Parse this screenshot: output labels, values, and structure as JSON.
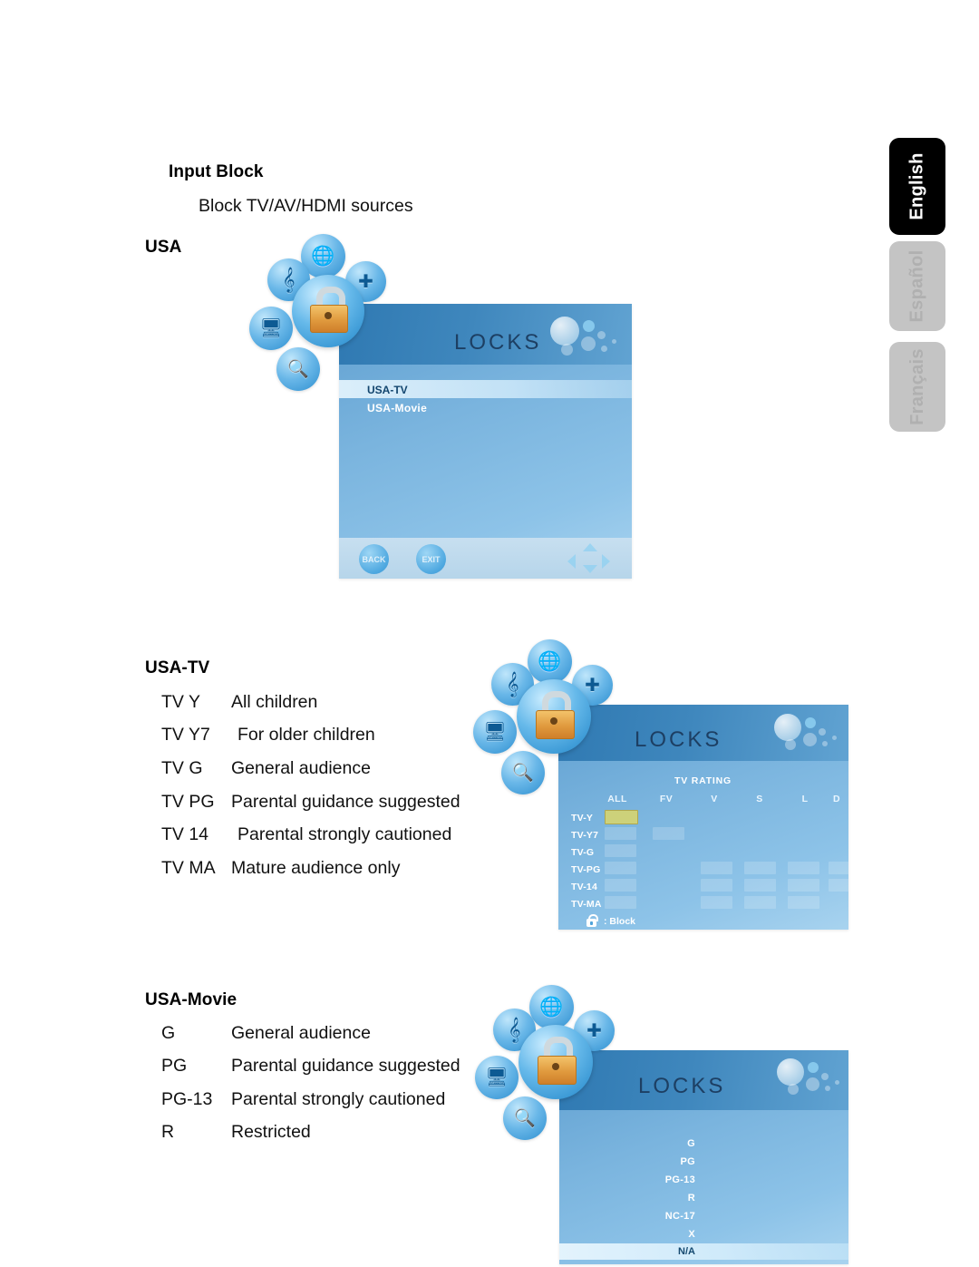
{
  "page": {
    "heading": "Input Block",
    "subheading": "Block TV/AV/HDMI sources",
    "usa_label": "USA"
  },
  "language_tabs": [
    {
      "label": "English",
      "active": true
    },
    {
      "label": "Español",
      "active": false
    },
    {
      "label": "Français",
      "active": false
    }
  ],
  "usa_tv": {
    "heading": "USA-TV",
    "rows": [
      {
        "code": "TV Y",
        "desc": "All children"
      },
      {
        "code": "TV Y7",
        "desc": "For older children"
      },
      {
        "code": "TV G",
        "desc": "General audience"
      },
      {
        "code": "TV PG",
        "desc": "Parental guidance suggested"
      },
      {
        "code": "TV 14",
        "desc": "Parental strongly cautioned"
      },
      {
        "code": "TV MA",
        "desc": "Mature audience only"
      }
    ]
  },
  "usa_movie": {
    "heading": "USA-Movie",
    "rows": [
      {
        "code": "G",
        "desc": "General audience"
      },
      {
        "code": "PG",
        "desc": "Parental guidance suggested"
      },
      {
        "code": "PG-13",
        "desc": "Parental strongly cautioned"
      },
      {
        "code": "R",
        "desc": "Restricted"
      }
    ]
  },
  "osd_locks_menu": {
    "title": "LOCKS",
    "items": [
      {
        "label": "USA-TV",
        "selected": true
      },
      {
        "label": "USA-Movie",
        "selected": false
      }
    ],
    "footer_buttons": [
      {
        "label": "BACK"
      },
      {
        "label": "EXIT"
      }
    ]
  },
  "osd_tv_rating": {
    "title": "LOCKS",
    "grid_title": "TV RATING",
    "columns": [
      "ALL",
      "FV",
      "V",
      "S",
      "L",
      "D"
    ],
    "rows": [
      "TV-Y",
      "TV-Y7",
      "TV-G",
      "TV-PG",
      "TV-14",
      "TV-MA"
    ],
    "legend": ": Block",
    "cursor": {
      "row": "TV-Y",
      "column": "ALL"
    }
  },
  "osd_movie_rating": {
    "title": "LOCKS",
    "items": [
      {
        "label": "G",
        "selected": false
      },
      {
        "label": "PG",
        "selected": false
      },
      {
        "label": "PG-13",
        "selected": false
      },
      {
        "label": "R",
        "selected": false
      },
      {
        "label": "NC-17",
        "selected": false
      },
      {
        "label": "X",
        "selected": false
      },
      {
        "label": "N/A",
        "selected": true
      }
    ]
  },
  "icons": {
    "lock": "lock-icon",
    "music": "music-note-icon",
    "globe_clock": "globe-clock-icon",
    "setup": "setup-icon",
    "picture": "picture-tv-icon",
    "tools": "tools-icon"
  },
  "colors": {
    "osd_header": "#3a7fb5",
    "osd_body": "#72abd8",
    "cursor_cell": "#cdd17a",
    "tab_active_bg": "#000000",
    "tab_inactive_bg": "#c4c4c4"
  }
}
